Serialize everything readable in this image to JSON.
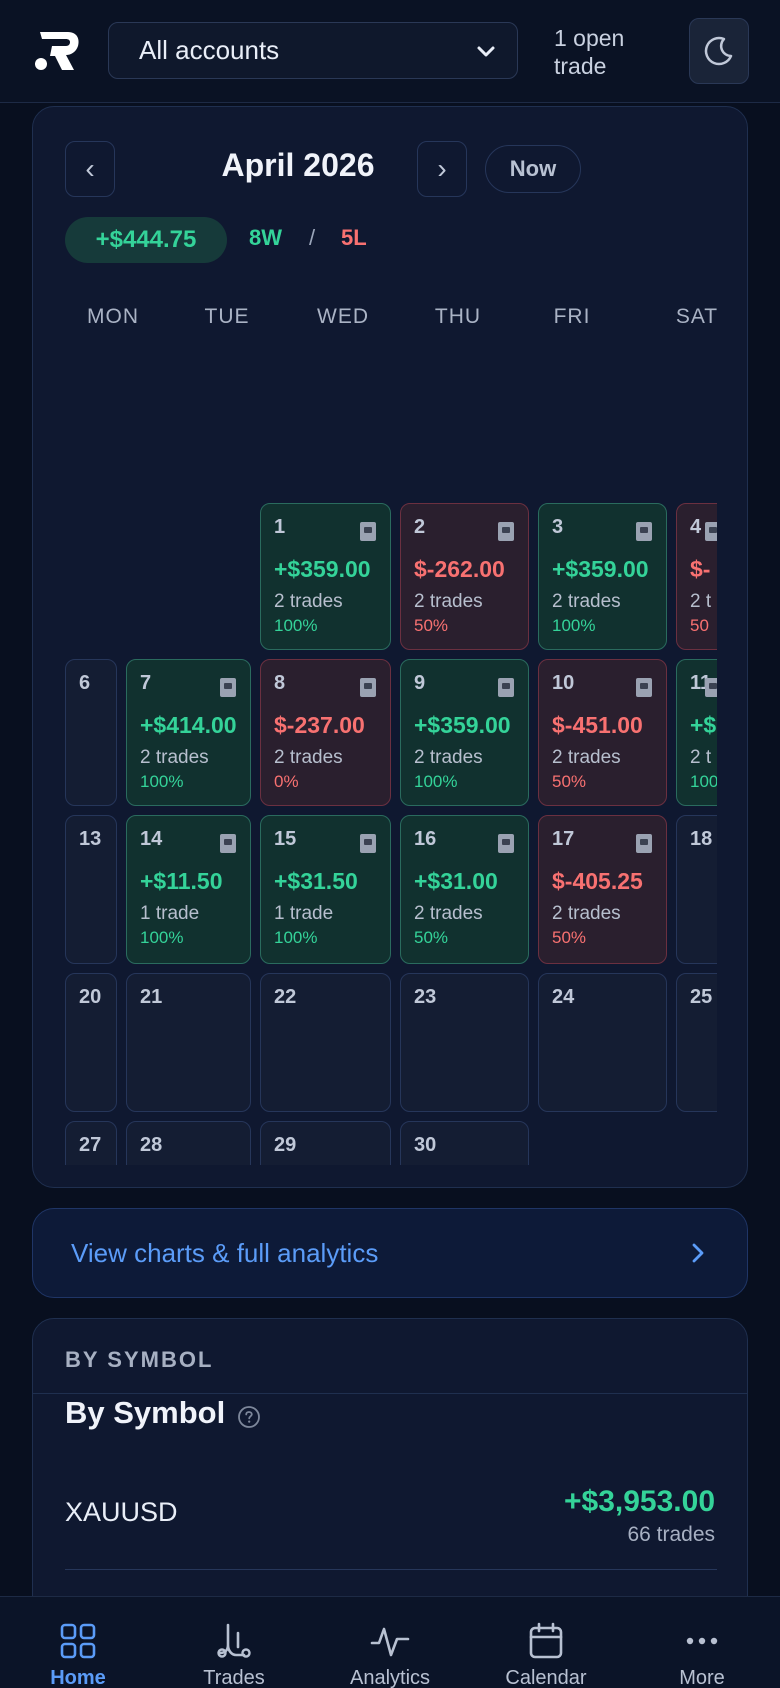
{
  "header": {
    "account_selector": "All accounts",
    "open_trades": "1 open trade"
  },
  "calendar": {
    "month": "April 2026",
    "prev_label": "‹",
    "next_label": "›",
    "now_label": "Now",
    "month_pnl": "+$444.75",
    "wins": "8W",
    "separator": "/",
    "losses": "5L",
    "weekdays": [
      "MON",
      "TUE",
      "WED",
      "THU",
      "FRI",
      "SAT"
    ],
    "days": [
      {
        "day": "1",
        "pnl": "+$359.00",
        "trades": "2 trades",
        "rate": "100%",
        "status": "win"
      },
      {
        "day": "2",
        "pnl": "$-262.00",
        "trades": "2 trades",
        "rate": "50%",
        "status": "loss"
      },
      {
        "day": "3",
        "pnl": "+$359.00",
        "trades": "2 trades",
        "rate": "100%",
        "status": "win"
      },
      {
        "day": "4",
        "pnl": "$-",
        "trades": "2 t",
        "rate": "50",
        "status": "loss"
      },
      {
        "day": "6",
        "status": "empty"
      },
      {
        "day": "7",
        "pnl": "+$414.00",
        "trades": "2 trades",
        "rate": "100%",
        "status": "win"
      },
      {
        "day": "8",
        "pnl": "$-237.00",
        "trades": "2 trades",
        "rate": "0%",
        "status": "loss"
      },
      {
        "day": "9",
        "pnl": "+$359.00",
        "trades": "2 trades",
        "rate": "100%",
        "status": "win"
      },
      {
        "day": "10",
        "pnl": "$-451.00",
        "trades": "2 trades",
        "rate": "50%",
        "status": "loss"
      },
      {
        "day": "11",
        "pnl": "+$",
        "trades": "2 t",
        "rate": "100",
        "status": "win"
      },
      {
        "day": "13",
        "status": "empty"
      },
      {
        "day": "14",
        "pnl": "+$11.50",
        "trades": "1 trade",
        "rate": "100%",
        "status": "win"
      },
      {
        "day": "15",
        "pnl": "+$31.50",
        "trades": "1 trade",
        "rate": "100%",
        "status": "win"
      },
      {
        "day": "16",
        "pnl": "+$31.00",
        "trades": "2 trades",
        "rate": "50%",
        "status": "win"
      },
      {
        "day": "17",
        "pnl": "$-405.25",
        "trades": "2 trades",
        "rate": "50%",
        "status": "loss"
      },
      {
        "day": "18",
        "status": "empty"
      },
      {
        "day": "20",
        "status": "empty"
      },
      {
        "day": "21",
        "status": "empty"
      },
      {
        "day": "22",
        "status": "empty"
      },
      {
        "day": "23",
        "status": "empty"
      },
      {
        "day": "24",
        "status": "empty"
      },
      {
        "day": "25",
        "status": "empty"
      },
      {
        "day": "27",
        "status": "empty"
      },
      {
        "day": "28",
        "status": "empty"
      },
      {
        "day": "29",
        "status": "empty"
      },
      {
        "day": "30",
        "status": "empty"
      }
    ]
  },
  "analytics_link": "View charts & full analytics",
  "by_symbol": {
    "kicker": "BY SYMBOL",
    "title": "By Symbol",
    "rows": [
      {
        "symbol": "XAUUSD",
        "pnl": "+$3,953.00",
        "trades": "66 trades"
      }
    ]
  },
  "bottom_nav": {
    "items": [
      {
        "label": "Home",
        "icon": "grid-icon",
        "active": true
      },
      {
        "label": "Trades",
        "icon": "trades-icon",
        "active": false
      },
      {
        "label": "Analytics",
        "icon": "pulse-icon",
        "active": false
      },
      {
        "label": "Calendar",
        "icon": "calendar-icon",
        "active": false
      },
      {
        "label": "More",
        "icon": "more-icon",
        "active": false
      }
    ]
  },
  "colors": {
    "profit": "#34d399",
    "loss": "#f87171",
    "accent": "#5b9cf8",
    "background": "#080f1f"
  }
}
